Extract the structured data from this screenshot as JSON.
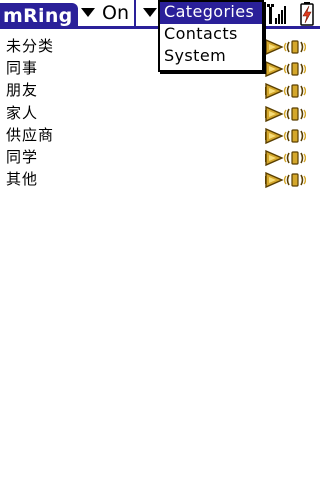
{
  "app": {
    "title": "mRing"
  },
  "toolbar": {
    "mode_value": "On",
    "category_selector": {
      "selected": "Categories"
    }
  },
  "popup": {
    "items": [
      "Categories",
      "Contacts",
      "System"
    ]
  },
  "groups": [
    {
      "label": "未分类"
    },
    {
      "label": "同事"
    },
    {
      "label": "朋友"
    },
    {
      "label": "家人"
    },
    {
      "label": "供应商"
    },
    {
      "label": "同学"
    },
    {
      "label": "其他"
    }
  ],
  "icons": {
    "row_play": "speaker-play-icon",
    "row_vibrate": "vibrate-icon",
    "status_signal": "signal-strength-icon",
    "status_battery": "battery-charging-icon"
  },
  "colors": {
    "title_bar": "#2a2099",
    "selection": "#2a2099",
    "icon_gold": "#d4a72c",
    "icon_dark": "#5a3f00"
  }
}
